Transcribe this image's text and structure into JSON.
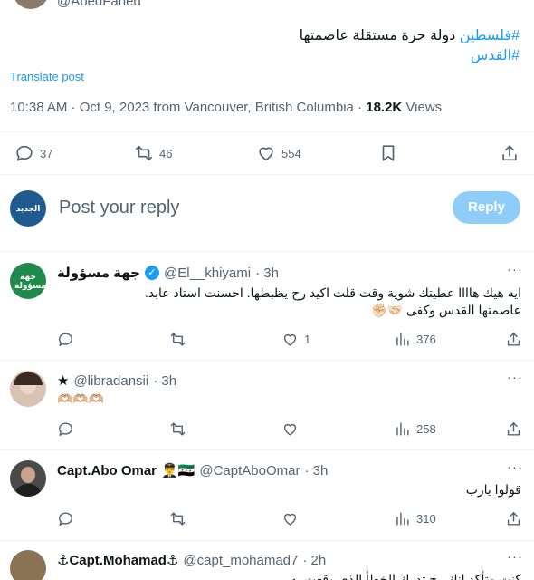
{
  "main_tweet": {
    "handle": "@AbedFahed",
    "line1_hashtag": "#فلسطين",
    "line1_text": " دولة حرة مستقلة عاصمتها",
    "line2_hashtag": "#القدس",
    "translate": "Translate post",
    "meta_time": "10:38 AM · Oct 9, 2023 from Vancouver, British Columbia · ",
    "meta_views_count": "18.2K",
    "meta_views_label": " Views",
    "stats": {
      "replies": "37",
      "reposts": "46",
      "likes": "554"
    }
  },
  "reply_box": {
    "placeholder": "Post your reply",
    "button": "Reply",
    "avatar_text": "الجديد"
  },
  "replies": [
    {
      "name": "جهة مسؤولة",
      "avatar_text": "جهة مسؤولة",
      "handle": "@El__khiyami",
      "time": "· 3h",
      "text_line1": "ايه هيك هاااا عطيتك شوية وقت قلت اكيد رح يظبطها. احسنت استاذ عابد.",
      "text_line2": "عاصمتها القدس وكفى 🤝🏻✊🏻",
      "stats": {
        "replies": "",
        "reposts": "",
        "likes": "1",
        "views": "376"
      }
    },
    {
      "name": "★",
      "handle": "@libradansii",
      "time": "· 3h",
      "text_line1": "🫶🏼🫶🏼🫶🏼",
      "stats": {
        "replies": "",
        "reposts": "",
        "likes": "",
        "views": "258"
      }
    },
    {
      "name": "Capt.Abo Omar",
      "name_emoji": "👨‍✈️🇸🇾",
      "handle": "@CaptAboOmar",
      "time": "· 3h",
      "text_line1": "قولوا يارب",
      "stats": {
        "replies": "",
        "reposts": "",
        "likes": "",
        "views": "310"
      }
    },
    {
      "name": "⚓Capt.Mohamad⚓",
      "handle": "@capt_mohamad7",
      "time": "· 2h",
      "text_line1": "كنت متأكد انك رح تدرك الخطأ الذي وقعت به"
    }
  ],
  "colors": {
    "accent": "#1d9bf0",
    "text": "#0f1419",
    "muted": "#536471",
    "divider": "#eff3f4",
    "reply_button": "#8ecdf7"
  }
}
